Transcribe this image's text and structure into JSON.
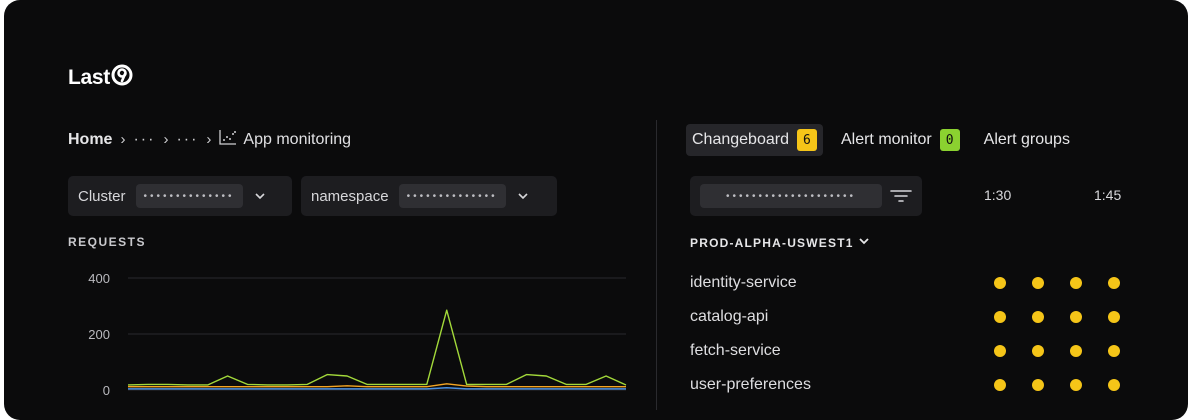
{
  "brand": {
    "logo_text": "Last"
  },
  "breadcrumb": {
    "home": "Home",
    "ellipsis_1": "···",
    "ellipsis_2": "···",
    "current": "App monitoring"
  },
  "filters": [
    {
      "label": "Cluster",
      "value": "••••••••••••••"
    },
    {
      "label": "namespace",
      "value": "••••••••••••••"
    }
  ],
  "requests": {
    "label": "REQUESTS"
  },
  "chart_data": {
    "type": "line",
    "title": "REQUESTS",
    "ylim": [
      0,
      400
    ],
    "yticks": [
      400,
      200,
      0
    ],
    "grid": true,
    "x": [
      0,
      4,
      8,
      12,
      16,
      20,
      24,
      28,
      32,
      36,
      40,
      44,
      48,
      52,
      56,
      60,
      64,
      68,
      72,
      76,
      80,
      84,
      88,
      92,
      96,
      100
    ],
    "series": [
      {
        "color": "#a3d93a",
        "values": [
          18,
          20,
          20,
          18,
          18,
          50,
          20,
          18,
          18,
          20,
          55,
          50,
          20,
          20,
          20,
          20,
          285,
          20,
          20,
          20,
          55,
          50,
          20,
          20,
          50,
          18
        ]
      },
      {
        "color": "#f5a623",
        "values": [
          12,
          12,
          12,
          12,
          12,
          12,
          12,
          12,
          12,
          12,
          12,
          15,
          12,
          12,
          12,
          12,
          22,
          14,
          12,
          12,
          12,
          12,
          12,
          12,
          12,
          12
        ]
      },
      {
        "color": "#4a90e2",
        "values": [
          4,
          4,
          4,
          4,
          4,
          4,
          4,
          4,
          4,
          4,
          4,
          4,
          4,
          4,
          4,
          4,
          8,
          4,
          4,
          4,
          4,
          4,
          4,
          4,
          4,
          4
        ]
      }
    ]
  },
  "tabs": [
    {
      "label": "Changeboard",
      "badge": "6",
      "badge_color": "#f5c518",
      "active": true
    },
    {
      "label": "Alert monitor",
      "badge": "0",
      "badge_color": "#8bd130",
      "active": false
    },
    {
      "label": "Alert groups",
      "badge": "",
      "active": false
    }
  ],
  "changeboard": {
    "search_value": "••••••••••••••••••••",
    "times": [
      "1:30",
      "1:45"
    ],
    "environment": "PROD-ALPHA-USWEST1",
    "services": [
      {
        "name": "identity-service",
        "events": 4
      },
      {
        "name": "catalog-api",
        "events": 4
      },
      {
        "name": "fetch-service",
        "events": 4
      },
      {
        "name": "user-preferences",
        "events": 4
      }
    ]
  },
  "colors": {
    "accent_yellow": "#f5c518",
    "accent_green": "#8bd130",
    "background": "#0b0b0c"
  }
}
